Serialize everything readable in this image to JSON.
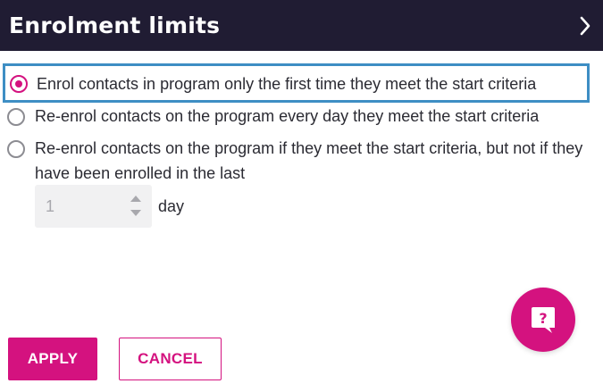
{
  "header": {
    "title": "Enrolment limits",
    "expand_icon": "chevron-right-icon"
  },
  "options": [
    {
      "label": "Enrol contacts in program only the first time they meet the start criteria",
      "selected": true
    },
    {
      "label": "Re-enrol contacts on the program every day they meet the start criteria",
      "selected": false
    },
    {
      "label": "Re-enrol contacts on the program if they meet the start criteria, but not if they have been enrolled in the last",
      "selected": false
    }
  ],
  "stepper": {
    "value": "1",
    "unit": "day"
  },
  "help": {
    "icon": "question-chat-icon",
    "glyph": "?"
  },
  "actions": {
    "apply_label": "APPLY",
    "cancel_label": "CANCEL"
  },
  "colors": {
    "accent": "#d4127f",
    "header_bg": "#201c33",
    "focus_ring": "#3e8ec4"
  }
}
